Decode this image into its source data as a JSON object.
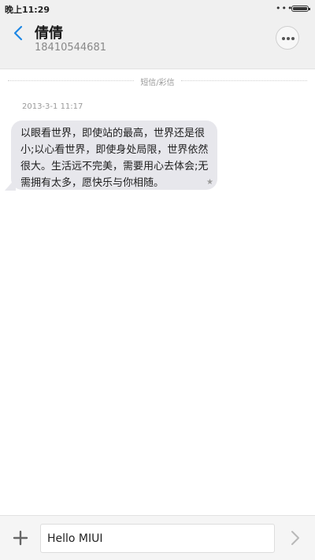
{
  "status_bar": {
    "time": "晚上11:29",
    "dots": "•••"
  },
  "header": {
    "contact_name": "倩倩",
    "contact_number": "18410544681"
  },
  "conversation": {
    "divider_label": "短信/彩信",
    "timestamp": "2013-3-1 11:17",
    "messages": [
      {
        "text": "以眼看世界，即使站的最高，世界还是很小;以心看世界，即使身处局限，世界依然很大。生活远不完美，需要用心去体会;无需拥有太多，愿快乐与你相随。",
        "starred": true
      }
    ]
  },
  "composer": {
    "input_value": "Hello MIUI"
  },
  "icons": {
    "back": "chevron-left-icon",
    "more": "more-icon",
    "star": "star-icon",
    "add": "plus-icon",
    "send": "chevron-right-icon"
  },
  "colors": {
    "accent": "#1e88e5",
    "bubble": "#e7e7ec",
    "header_bg": "#f0f0f0"
  }
}
